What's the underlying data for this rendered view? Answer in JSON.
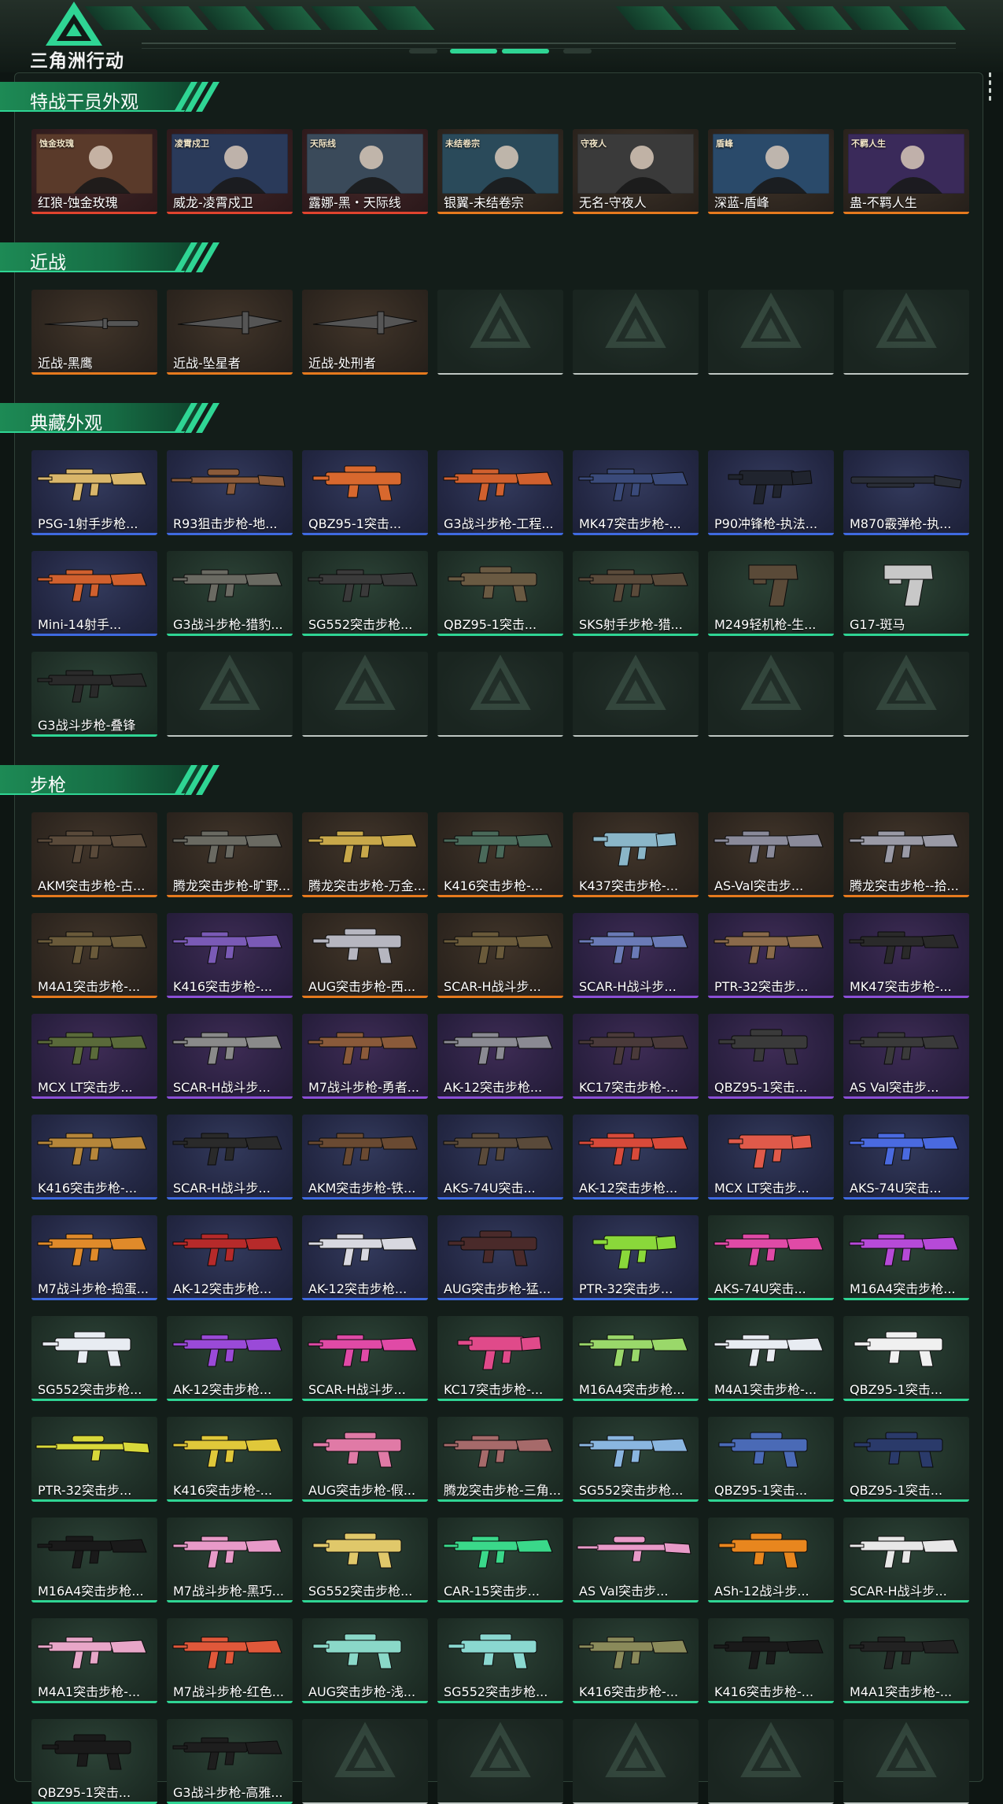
{
  "app": {
    "logo_text": "三角洲行动"
  },
  "colors": {
    "accent": "#2fd594",
    "rarity_red": "#e0442e",
    "rarity_orange": "#e67a1e",
    "rarity_gold": "#e0a62b",
    "rarity_purple": "#8b4fd6",
    "rarity_blue": "#3f6ae0",
    "rarity_green": "#2fd594"
  },
  "sections": [
    {
      "title": "特战干员外观",
      "rows": [
        [
          {
            "label": "红狼-蚀金玫瑰",
            "rarity": "red",
            "kind": "photo",
            "art": "operator-portrait",
            "photo_title": "蚀金玫瑰"
          },
          {
            "label": "威龙-凌霄戍卫",
            "rarity": "red",
            "kind": "photo",
            "art": "operator-portrait",
            "photo_title": "凌霄戍卫"
          },
          {
            "label": "露娜-黑・天际线",
            "rarity": "red",
            "kind": "photo",
            "art": "operator-portrait",
            "photo_title": "天际线"
          },
          {
            "label": "银翼-未结卷宗",
            "rarity": "orange",
            "kind": "photo",
            "art": "operator-portrait",
            "photo_title": "未结卷宗"
          },
          {
            "label": "无名-守夜人",
            "rarity": "orange",
            "kind": "photo",
            "art": "operator-portrait",
            "photo_title": "守夜人"
          },
          {
            "label": "深蓝-盾峰",
            "rarity": "orange",
            "kind": "photo",
            "art": "operator-portrait",
            "photo_title": "盾峰"
          },
          {
            "label": "蛊-不羁人生",
            "rarity": "orange",
            "kind": "photo",
            "art": "operator-portrait",
            "photo_title": "不羁人生"
          }
        ]
      ]
    },
    {
      "title": "近战",
      "rows": [
        [
          {
            "label": "近战-黑鹰",
            "rarity": "orange",
            "kind": "photo",
            "art": "knife-icon"
          },
          {
            "label": "近战-坠星者",
            "rarity": "orange",
            "kind": "item",
            "art": "blade-icon"
          },
          {
            "label": "近战-处刑者",
            "rarity": "orange",
            "kind": "item",
            "art": "blade-icon"
          },
          {
            "kind": "empty"
          },
          {
            "kind": "empty"
          },
          {
            "kind": "empty"
          },
          {
            "kind": "empty"
          }
        ]
      ]
    },
    {
      "title": "典藏外观",
      "rows": [
        [
          {
            "label": "PSG-1射手步枪...",
            "rarity": "blue",
            "kind": "item",
            "art": "rifle-icon",
            "tint": "#d9b66a"
          },
          {
            "label": "R93狙击步枪-地...",
            "rarity": "blue",
            "kind": "item",
            "art": "sniper-icon",
            "tint": "#8a5a3a"
          },
          {
            "label": "QBZ95-1突击...",
            "rarity": "blue",
            "kind": "item",
            "art": "bullpup-icon",
            "tint": "#d8682e"
          },
          {
            "label": "G3战斗步枪-工程...",
            "rarity": "blue",
            "kind": "item",
            "art": "rifle-icon",
            "tint": "#d0602e"
          },
          {
            "label": "MK47突击步枪-...",
            "rarity": "blue",
            "kind": "item",
            "art": "rifle-icon",
            "tint": "#3a4a7a"
          },
          {
            "label": "P90冲锋枪-执法...",
            "rarity": "blue",
            "kind": "item",
            "art": "smg-icon",
            "tint": "#20242e"
          },
          {
            "label": "M870霰弹枪-执...",
            "rarity": "blue",
            "kind": "item",
            "art": "shotgun-icon",
            "tint": "#2a2e38"
          }
        ],
        [
          {
            "label": "Mini-14射手...",
            "rarity": "blue",
            "kind": "item",
            "art": "rifle-icon",
            "tint": "#d0602e"
          },
          {
            "label": "G3战斗步枪-猎豹...",
            "rarity": "green",
            "kind": "item",
            "art": "rifle-icon",
            "tint": "#6a6a62"
          },
          {
            "label": "SG552突击步枪...",
            "rarity": "green",
            "kind": "item",
            "art": "rifle-icon",
            "tint": "#3a3a3a"
          },
          {
            "label": "QBZ95-1突击...",
            "rarity": "green",
            "kind": "item",
            "art": "bullpup-icon",
            "tint": "#6a5a42"
          },
          {
            "label": "SKS射手步枪-猎...",
            "rarity": "green",
            "kind": "item",
            "art": "rifle-icon",
            "tint": "#5a4a3a"
          },
          {
            "label": "M249轻机枪-生...",
            "rarity": "green",
            "kind": "item",
            "art": "pistol-icon",
            "tint": "#5a4a38"
          },
          {
            "label": "G17-斑马",
            "rarity": "green",
            "kind": "item",
            "art": "pistol-icon",
            "tint": "#c8c8c8"
          }
        ],
        [
          {
            "label": "G3战斗步枪-叠锋",
            "rarity": "green",
            "kind": "item",
            "art": "rifle-icon",
            "tint": "#2a2a2a"
          },
          {
            "kind": "empty"
          },
          {
            "kind": "empty"
          },
          {
            "kind": "empty"
          },
          {
            "kind": "empty"
          },
          {
            "kind": "empty"
          },
          {
            "kind": "empty"
          }
        ]
      ]
    },
    {
      "title": "步枪",
      "rows": [
        [
          {
            "label": "AKM突击步枪-古...",
            "rarity": "orange",
            "kind": "item",
            "art": "rifle-icon",
            "tint": "#5a4a3a"
          },
          {
            "label": "腾龙突击步枪-旷野...",
            "rarity": "orange",
            "kind": "item",
            "art": "rifle-icon",
            "tint": "#6a6a62"
          },
          {
            "label": "腾龙突击步枪-万金...",
            "rarity": "orange",
            "kind": "item",
            "art": "rifle-icon",
            "tint": "#c8a84a"
          },
          {
            "label": "K416突击步枪-...",
            "rarity": "orange",
            "kind": "item",
            "art": "rifle-icon",
            "tint": "#4a6a5a"
          },
          {
            "label": "K437突击步枪-...",
            "rarity": "orange",
            "kind": "item",
            "art": "smg-icon",
            "tint": "#8ab6c8"
          },
          {
            "label": "AS-Val突击步...",
            "rarity": "orange",
            "kind": "item",
            "art": "rifle-icon",
            "tint": "#8a8a9a"
          },
          {
            "label": "腾龙突击步枪--拾...",
            "rarity": "orange",
            "kind": "item",
            "art": "rifle-icon",
            "tint": "#9a9aa6"
          }
        ],
        [
          {
            "label": "M4A1突击步枪-...",
            "rarity": "orange",
            "kind": "item",
            "art": "rifle-icon",
            "tint": "#6a5a3a"
          },
          {
            "label": "K416突击步枪-...",
            "rarity": "purple",
            "kind": "item",
            "art": "rifle-icon",
            "tint": "#7a5ab6"
          },
          {
            "label": "AUG突击步枪-西...",
            "rarity": "orange",
            "kind": "item",
            "art": "bullpup-icon",
            "tint": "#b6b6c0"
          },
          {
            "label": "SCAR-H战斗步...",
            "rarity": "orange",
            "kind": "item",
            "art": "rifle-icon",
            "tint": "#6a5a3a"
          },
          {
            "label": "SCAR-H战斗步...",
            "rarity": "purple",
            "kind": "item",
            "art": "rifle-icon",
            "tint": "#6a7ab6"
          },
          {
            "label": "PTR-32突击步...",
            "rarity": "purple",
            "kind": "item",
            "art": "rifle-icon",
            "tint": "#8a6a4a"
          },
          {
            "label": "MK47突击步枪-...",
            "rarity": "purple",
            "kind": "item",
            "art": "rifle-icon",
            "tint": "#2a2a2a"
          }
        ],
        [
          {
            "label": "MCX LT突击步...",
            "rarity": "purple",
            "kind": "item",
            "art": "rifle-icon",
            "tint": "#5a6a3a"
          },
          {
            "label": "SCAR-H战斗步...",
            "rarity": "purple",
            "kind": "item",
            "art": "rifle-icon",
            "tint": "#8a8a8a"
          },
          {
            "label": "M7战斗步枪-勇者...",
            "rarity": "purple",
            "kind": "item",
            "art": "rifle-icon",
            "tint": "#8a5a3a"
          },
          {
            "label": "AK-12突击步枪...",
            "rarity": "purple",
            "kind": "item",
            "art": "rifle-icon",
            "tint": "#8a8a92"
          },
          {
            "label": "KC17突击步枪-...",
            "rarity": "purple",
            "kind": "item",
            "art": "rifle-icon",
            "tint": "#4a3a3a"
          },
          {
            "label": "QBZ95-1突击...",
            "rarity": "purple",
            "kind": "item",
            "art": "bullpup-icon",
            "tint": "#3a3a3a"
          },
          {
            "label": "AS Val突击步...",
            "rarity": "purple",
            "kind": "item",
            "art": "rifle-icon",
            "tint": "#3a3a3a"
          }
        ],
        [
          {
            "label": "K416突击步枪-...",
            "rarity": "blue",
            "kind": "item",
            "art": "rifle-icon",
            "tint": "#b6863a"
          },
          {
            "label": "SCAR-H战斗步...",
            "rarity": "blue",
            "kind": "item",
            "art": "rifle-icon",
            "tint": "#2a2a2a"
          },
          {
            "label": "AKM突击步枪-铁...",
            "rarity": "blue",
            "kind": "item",
            "art": "rifle-icon",
            "tint": "#6a4a32"
          },
          {
            "label": "AKS-74U突击...",
            "rarity": "blue",
            "kind": "item",
            "art": "rifle-icon",
            "tint": "#5a4a3a"
          },
          {
            "label": "AK-12突击步枪...",
            "rarity": "blue",
            "kind": "item",
            "art": "rifle-icon",
            "tint": "#d84a3a"
          },
          {
            "label": "MCX LT突击步...",
            "rarity": "blue",
            "kind": "item",
            "art": "smg-icon",
            "tint": "#e05a4a"
          },
          {
            "label": "AKS-74U突击...",
            "rarity": "blue",
            "kind": "item",
            "art": "rifle-icon",
            "tint": "#4a6ae0"
          }
        ],
        [
          {
            "label": "M7战斗步枪-捣蛋...",
            "rarity": "blue",
            "kind": "item",
            "art": "rifle-icon",
            "tint": "#e08a2a"
          },
          {
            "label": "AK-12突击步枪...",
            "rarity": "blue",
            "kind": "item",
            "art": "rifle-icon",
            "tint": "#b62a2a"
          },
          {
            "label": "AK-12突击步枪...",
            "rarity": "blue",
            "kind": "item",
            "art": "rifle-icon",
            "tint": "#d8d8e0"
          },
          {
            "label": "AUG突击步枪-猛...",
            "rarity": "blue",
            "kind": "item",
            "art": "bullpup-icon",
            "tint": "#4a2a2a"
          },
          {
            "label": "PTR-32突击步...",
            "rarity": "blue",
            "kind": "item",
            "art": "smg-icon",
            "tint": "#8ad83a"
          },
          {
            "label": "AKS-74U突击...",
            "rarity": "green",
            "kind": "item",
            "art": "rifle-icon",
            "tint": "#e04aa6"
          },
          {
            "label": "M16A4突击步枪...",
            "rarity": "green",
            "kind": "item",
            "art": "rifle-icon",
            "tint": "#b64ad8"
          }
        ],
        [
          {
            "label": "SG552突击步枪...",
            "rarity": "green",
            "kind": "item",
            "art": "bullpup-icon",
            "tint": "#e8ecf2"
          },
          {
            "label": "AK-12突击步枪...",
            "rarity": "green",
            "kind": "item",
            "art": "rifle-icon",
            "tint": "#9a4ad8"
          },
          {
            "label": "SCAR-H战斗步...",
            "rarity": "green",
            "kind": "item",
            "art": "rifle-icon",
            "tint": "#e04aa6"
          },
          {
            "label": "KC17突击步枪-...",
            "rarity": "green",
            "kind": "item",
            "art": "smg-icon",
            "tint": "#e04a8a"
          },
          {
            "label": "M16A4突击步枪...",
            "rarity": "green",
            "kind": "item",
            "art": "rifle-icon",
            "tint": "#9ad86a"
          },
          {
            "label": "M4A1突击步枪-...",
            "rarity": "green",
            "kind": "item",
            "art": "rifle-icon",
            "tint": "#e8ecf2"
          },
          {
            "label": "QBZ95-1突击...",
            "rarity": "green",
            "kind": "item",
            "art": "bullpup-icon",
            "tint": "#f0f0f0"
          }
        ],
        [
          {
            "label": "PTR-32突击步...",
            "rarity": "green",
            "kind": "item",
            "art": "sniper-icon",
            "tint": "#d8d83a"
          },
          {
            "label": "K416突击步枪-...",
            "rarity": "green",
            "kind": "item",
            "art": "rifle-icon",
            "tint": "#e0c83a"
          },
          {
            "label": "AUG突击步枪-假...",
            "rarity": "green",
            "kind": "item",
            "art": "bullpup-icon",
            "tint": "#e07aa6"
          },
          {
            "label": "腾龙突击步枪-三角...",
            "rarity": "green",
            "kind": "item",
            "art": "rifle-icon",
            "tint": "#a66a6a"
          },
          {
            "label": "SG552突击步枪...",
            "rarity": "green",
            "kind": "item",
            "art": "rifle-icon",
            "tint": "#8ab6e0"
          },
          {
            "label": "QBZ95-1突击...",
            "rarity": "green",
            "kind": "item",
            "art": "bullpup-icon",
            "tint": "#4a6ab6"
          },
          {
            "label": "QBZ95-1突击...",
            "rarity": "green",
            "kind": "item",
            "art": "bullpup-icon",
            "tint": "#2a3a6a"
          }
        ],
        [
          {
            "label": "M16A4突击步枪...",
            "rarity": "green",
            "kind": "item",
            "art": "rifle-icon",
            "tint": "#1a1a1a"
          },
          {
            "label": "M7战斗步枪-黑巧...",
            "rarity": "green",
            "kind": "item",
            "art": "rifle-icon",
            "tint": "#e89ac8"
          },
          {
            "label": "SG552突击步枪...",
            "rarity": "green",
            "kind": "item",
            "art": "bullpup-icon",
            "tint": "#e0c86a"
          },
          {
            "label": "CAR-15突击步...",
            "rarity": "green",
            "kind": "item",
            "art": "rifle-icon",
            "tint": "#3ad88a"
          },
          {
            "label": "AS Val突击步...",
            "rarity": "green",
            "kind": "item",
            "art": "sniper-icon",
            "tint": "#e89ac8"
          },
          {
            "label": "ASh-12战斗步...",
            "rarity": "green",
            "kind": "item",
            "art": "bullpup-icon",
            "tint": "#e8861e"
          },
          {
            "label": "SCAR-H战斗步...",
            "rarity": "green",
            "kind": "item",
            "art": "rifle-icon",
            "tint": "#e8e8e8"
          }
        ],
        [
          {
            "label": "M4A1突击步枪-...",
            "rarity": "green",
            "kind": "item",
            "art": "rifle-icon",
            "tint": "#e8a6c8"
          },
          {
            "label": "M7战斗步枪-红色...",
            "rarity": "green",
            "kind": "item",
            "art": "rifle-icon",
            "tint": "#e0583a"
          },
          {
            "label": "AUG突击步枪-浅...",
            "rarity": "green",
            "kind": "item",
            "art": "bullpup-icon",
            "tint": "#8ad8c8"
          },
          {
            "label": "SG552突击步枪...",
            "rarity": "green",
            "kind": "item",
            "art": "bullpup-icon",
            "tint": "#8ad8d0"
          },
          {
            "label": "K416突击步枪-...",
            "rarity": "green",
            "kind": "item",
            "art": "rifle-icon",
            "tint": "#8a8a5a"
          },
          {
            "label": "K416突击步枪-...",
            "rarity": "green",
            "kind": "item",
            "art": "rifle-icon",
            "tint": "#1a1a1a"
          },
          {
            "label": "M4A1突击步枪-...",
            "rarity": "green",
            "kind": "item",
            "art": "rifle-icon",
            "tint": "#222222"
          }
        ],
        [
          {
            "label": "QBZ95-1突击...",
            "rarity": "green",
            "kind": "item",
            "art": "bullpup-icon",
            "tint": "#1a1a1a"
          },
          {
            "label": "G3战斗步枪-高雅...",
            "rarity": "green",
            "kind": "item",
            "art": "rifle-icon",
            "tint": "#1e1e1e"
          },
          {
            "kind": "empty"
          },
          {
            "kind": "empty"
          },
          {
            "kind": "empty"
          },
          {
            "kind": "empty"
          },
          {
            "kind": "empty"
          }
        ]
      ]
    }
  ]
}
